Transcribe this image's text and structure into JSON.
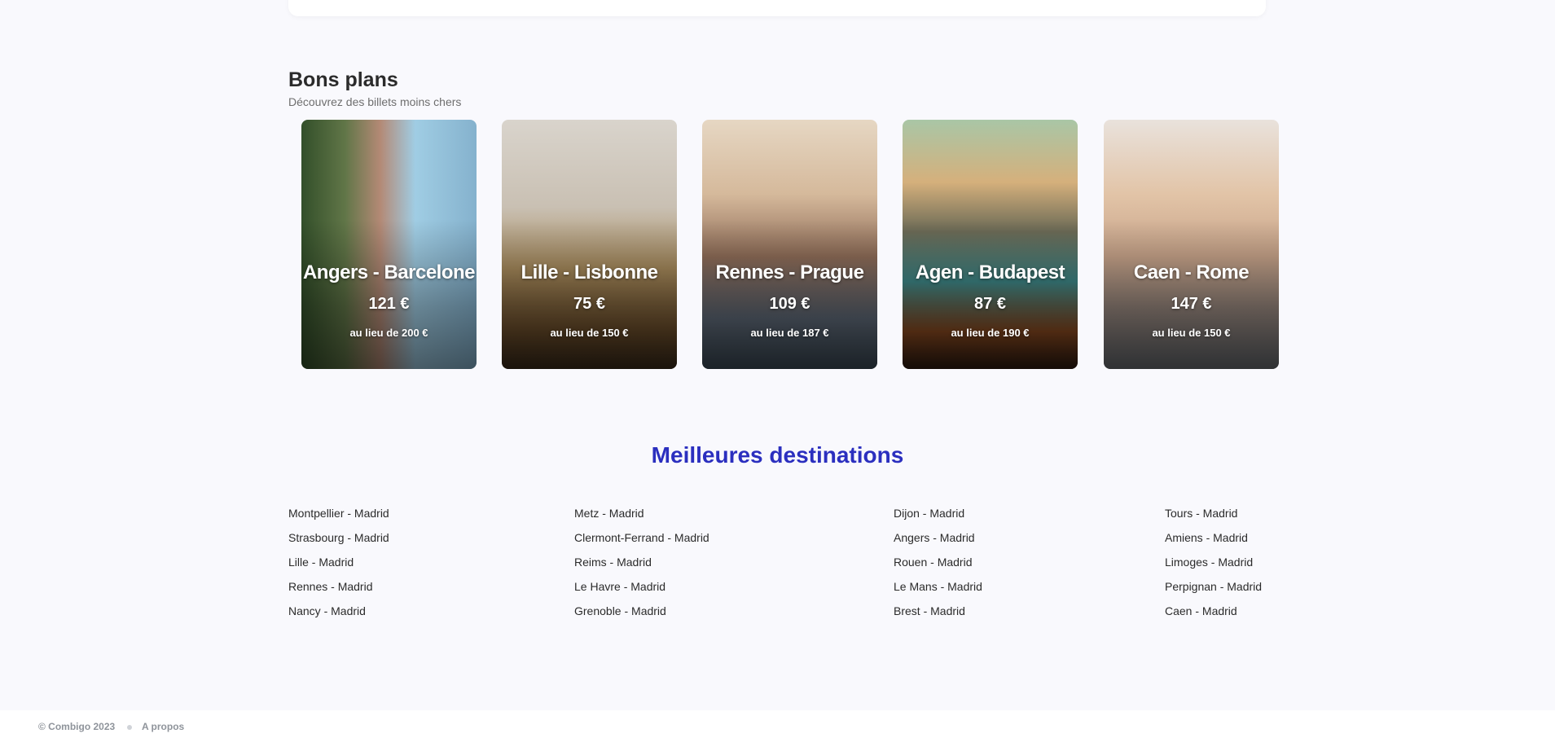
{
  "deals": {
    "title": "Bons plans",
    "subtitle": "Découvrez des billets moins chers",
    "cards": [
      {
        "route": "Angers - Barcelone",
        "price": "121 €",
        "was": "au lieu de 200 €"
      },
      {
        "route": "Lille - Lisbonne",
        "price": "75 €",
        "was": "au lieu de 150 €"
      },
      {
        "route": "Rennes - Prague",
        "price": "109 €",
        "was": "au lieu de 187 €"
      },
      {
        "route": "Agen - Budapest",
        "price": "87 €",
        "was": "au lieu de 190 €"
      },
      {
        "route": "Caen - Rome",
        "price": "147 €",
        "was": "au lieu de 150 €"
      }
    ]
  },
  "destinations": {
    "title": "Meilleures destinations",
    "columns": [
      [
        "Montpellier - Madrid",
        "Strasbourg - Madrid",
        "Lille - Madrid",
        "Rennes - Madrid",
        "Nancy - Madrid"
      ],
      [
        "Metz - Madrid",
        "Clermont-Ferrand - Madrid",
        "Reims - Madrid",
        "Le Havre - Madrid",
        "Grenoble - Madrid"
      ],
      [
        "Dijon - Madrid",
        "Angers - Madrid",
        "Rouen - Madrid",
        "Le Mans - Madrid",
        "Brest - Madrid"
      ],
      [
        "Tours - Madrid",
        "Amiens - Madrid",
        "Limoges - Madrid",
        "Perpignan - Madrid",
        "Caen - Madrid"
      ]
    ]
  },
  "footer": {
    "copyright": "© Combigo 2023",
    "about": "A propos"
  },
  "colors": {
    "accent": "#2b2fbf",
    "background": "#f9f9fd"
  }
}
